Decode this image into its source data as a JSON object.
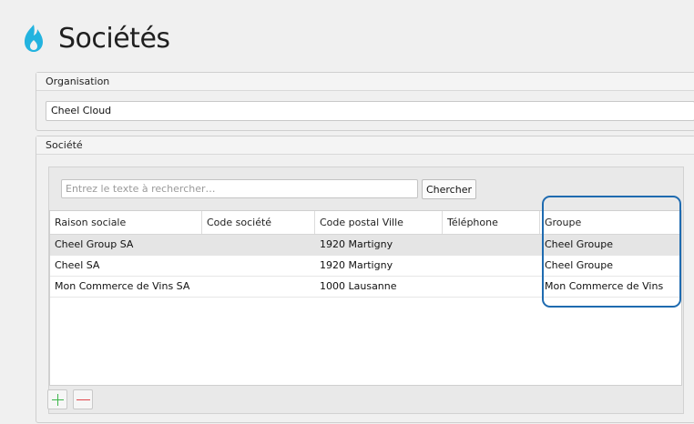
{
  "page": {
    "title": "Sociétés"
  },
  "organisation": {
    "section_label": "Organisation",
    "value": "Cheel Cloud"
  },
  "societe": {
    "section_label": "Société",
    "search": {
      "placeholder": "Entrez le texte à rechercher…",
      "value": ""
    },
    "search_button_label": "Chercher",
    "table": {
      "columns": [
        "Raison sociale",
        "Code société",
        "Code postal Ville",
        "Téléphone",
        "Groupe"
      ],
      "rows": [
        [
          "Cheel Group SA",
          "",
          "1920 Martigny",
          "",
          "Cheel Groupe"
        ],
        [
          "Cheel SA",
          "",
          "1920 Martigny",
          "",
          "Cheel Groupe"
        ],
        [
          "Mon Commerce de Vins SA",
          "",
          "1000 Lausanne",
          "",
          "Mon Commerce de Vins"
        ]
      ],
      "selected_row": 0
    }
  },
  "icons": {
    "logo": "flame-icon",
    "add": "plus-icon",
    "remove": "minus-icon"
  },
  "colors": {
    "accent": "#23b3df",
    "highlight": "#1f6bb0",
    "add": "#3cb54a",
    "remove": "#e0474c"
  }
}
